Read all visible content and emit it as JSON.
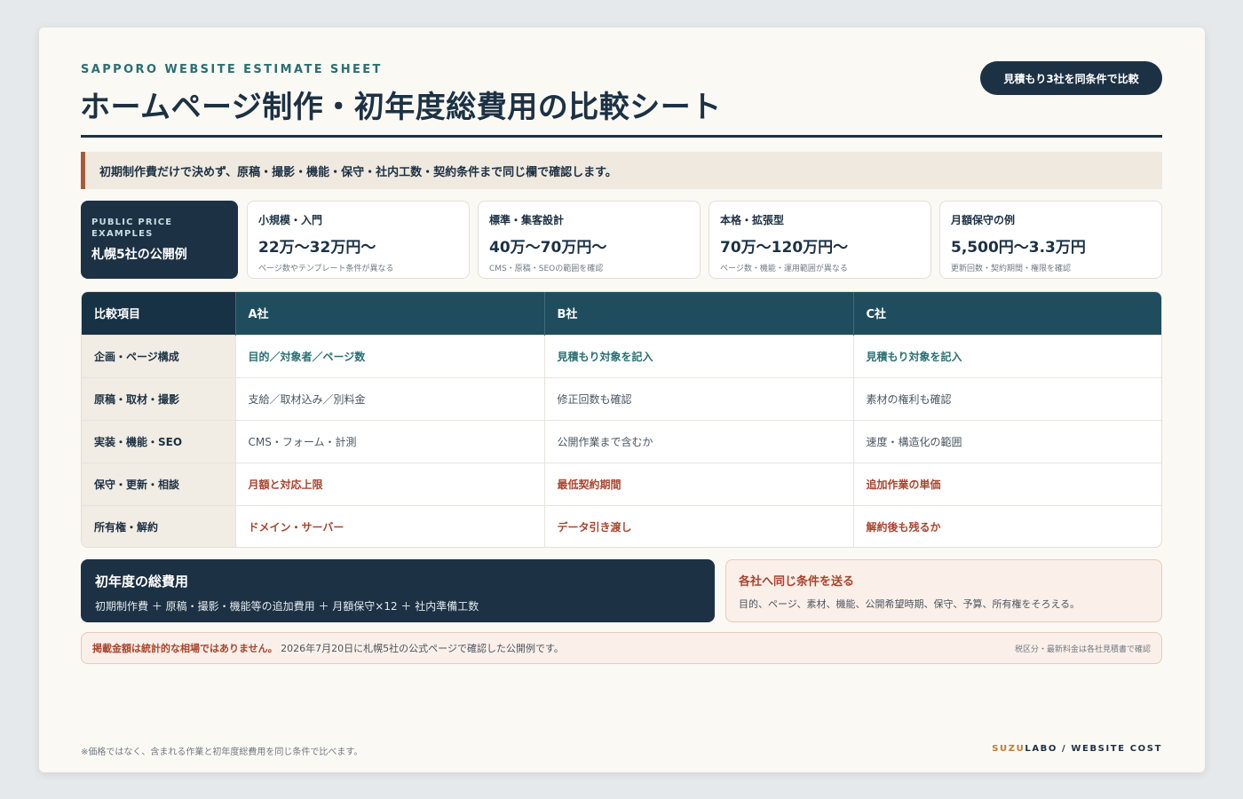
{
  "header": {
    "eyebrow": "SAPPORO WEBSITE ESTIMATE SHEET",
    "title": "ホームページ制作・初年度総費用の比較シート",
    "badge": "見積もり3社を同条件で比較"
  },
  "notice": "初期制作費だけで決めず、原稿・撮影・機能・保守・社内工数・契約条件まで同じ欄で確認します。",
  "price_examples": {
    "label_en": "PUBLIC PRICE EXAMPLES",
    "label_jp": "札幌5社の公開例",
    "cards": [
      {
        "category": "小規模・入門",
        "amount": "22万〜32万円〜",
        "note": "ページ数やテンプレート条件が異なる"
      },
      {
        "category": "標準・集客設計",
        "amount": "40万〜70万円〜",
        "note": "CMS・原稿・SEOの範囲を確認"
      },
      {
        "category": "本格・拡張型",
        "amount": "70万〜120万円〜",
        "note": "ページ数・機能・運用範囲が異なる"
      },
      {
        "category": "月額保守の例",
        "amount": "5,500円〜3.3万円",
        "note": "更新回数・契約期間・権限を確認"
      }
    ]
  },
  "table": {
    "headers": [
      "比較項目",
      "A社",
      "B社",
      "C社"
    ],
    "rows": [
      {
        "label": "企画・ページ構成",
        "cells": [
          "目的／対象者／ページ数",
          "見積もり対象を記入",
          "見積もり対象を記入"
        ],
        "style": "teal"
      },
      {
        "label": "原稿・取材・撮影",
        "cells": [
          "支給／取材込み／別料金",
          "修正回数も確認",
          "素材の権利も確認"
        ],
        "style": "plain"
      },
      {
        "label": "実装・機能・SEO",
        "cells": [
          "CMS・フォーム・計測",
          "公開作業まで含むか",
          "速度・構造化の範囲"
        ],
        "style": "plain"
      },
      {
        "label": "保守・更新・相談",
        "cells": [
          "月額と対応上限",
          "最低契約期間",
          "追加作業の単価"
        ],
        "style": "red"
      },
      {
        "label": "所有権・解約",
        "cells": [
          "ドメイン・サーバー",
          "データ引き渡し",
          "解約後も残るか"
        ],
        "style": "red"
      }
    ]
  },
  "total": {
    "heading": "初年度の総費用",
    "formula": "初期制作費 ＋ 原稿・撮影・機能等の追加費用 ＋ 月額保守×12 ＋ 社内準備工数"
  },
  "send": {
    "heading": "各社へ同じ条件を送る",
    "body": "目的、ページ、素材、機能、公開希望時期、保守、予算、所有権をそろえる。"
  },
  "disclaimer": {
    "bold": "掲載金額は統計的な相場ではありません。",
    "text": "2026年7月20日に札幌5社の公式ページで確認した公開例です。",
    "right": "税区分・最新料金は各社見積書で確認"
  },
  "footer": {
    "note": "※価格ではなく、含まれる作業と初年度総費用を同じ条件で比べます。",
    "brand_accent": "SUZU",
    "brand_rest": "LABO / WEBSITE COST"
  }
}
